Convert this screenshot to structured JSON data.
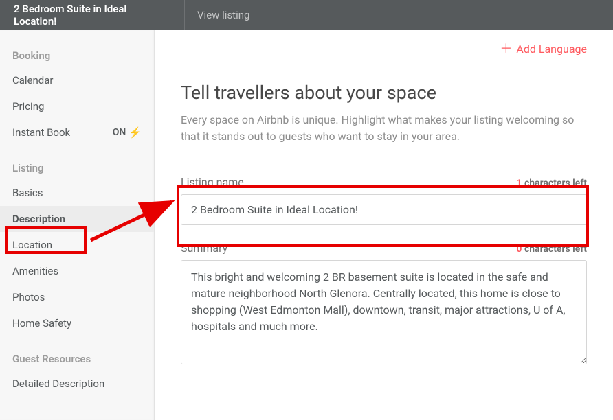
{
  "topbar": {
    "title": "2 Bedroom Suite in Ideal Location!",
    "view_listing": "View listing"
  },
  "sidebar": {
    "sections": [
      {
        "header": "Booking",
        "items": [
          {
            "label": "Calendar"
          },
          {
            "label": "Pricing"
          },
          {
            "label": "Instant Book",
            "toggle": "ON"
          }
        ]
      },
      {
        "header": "Listing",
        "items": [
          {
            "label": "Basics"
          },
          {
            "label": "Description",
            "active": true
          },
          {
            "label": "Location"
          },
          {
            "label": "Amenities"
          },
          {
            "label": "Photos"
          },
          {
            "label": "Home Safety"
          }
        ]
      },
      {
        "header": "Guest Resources",
        "items": [
          {
            "label": "Detailed Description"
          }
        ]
      }
    ]
  },
  "main": {
    "add_language": "Add Language",
    "heading": "Tell travellers about your space",
    "subtitle": "Every space on Airbnb is unique. Highlight what makes your listing welcoming so that it stands out to guests who want to stay in your area.",
    "listing_name": {
      "label": "Listing name",
      "chars_left": "1",
      "chars_suffix": "characters left",
      "value": "2 Bedroom Suite in Ideal Location!"
    },
    "summary": {
      "label": "Summary",
      "chars_left": "0",
      "chars_suffix": "characters left",
      "value": "This bright and welcoming 2 BR basement suite is located in the safe and mature neighborhood North Glenora. Centrally located, this home is close to shopping (West Edmonton Mall), downtown, transit, major attractions, U of A, hospitals and much more."
    }
  }
}
